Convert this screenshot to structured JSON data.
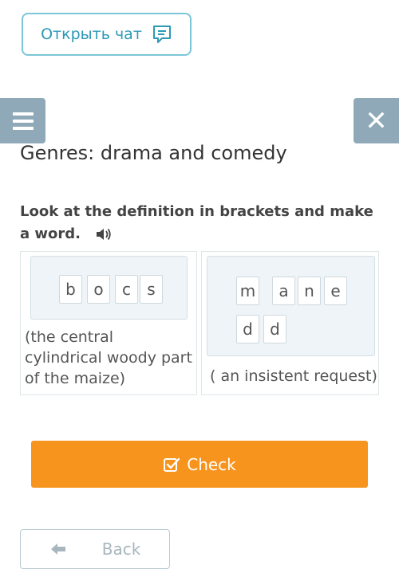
{
  "chat_button": {
    "label": "Открыть чат",
    "icon": "chat-icon"
  },
  "header": {
    "menu_icon": "hamburger-menu-icon",
    "close_icon": "close-icon",
    "close_glyph": "✕"
  },
  "title": "Genres: drama and comedy",
  "instruction": "Look at the definition in brackets and make a word.",
  "cards": [
    {
      "letters": [
        "b",
        "o",
        "c",
        "s"
      ],
      "definition": "(the central cylindrical woody part of the maize)"
    },
    {
      "letters": [
        "m",
        "a",
        "n",
        "e",
        "d",
        "d"
      ],
      "definition": "( an insistent request)"
    }
  ],
  "check_button": {
    "label": "Check",
    "icon": "checkbox-icon"
  },
  "back_button": {
    "label": "Back",
    "icon": "arrow-left-icon"
  },
  "colors": {
    "accent": "#2c9ab7",
    "check": "#f7941d",
    "header_buttons": "#8fa9b9"
  }
}
